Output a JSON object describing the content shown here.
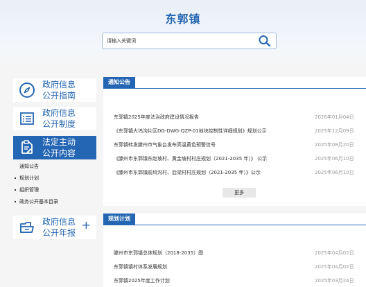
{
  "header": {
    "site_title": "东郭镇",
    "search_placeholder": "请输入关键词"
  },
  "nav": {
    "items": [
      {
        "line1": "政府信息",
        "line2": "公开指南",
        "icon": "compass-icon"
      },
      {
        "line1": "政府信息",
        "line2": "公开制度",
        "icon": "document-list-icon"
      },
      {
        "line1": "法定主动",
        "line2": "公开内容",
        "icon": "edit-document-icon",
        "active": true
      },
      {
        "line1": "政府信息",
        "line2": "公开年报",
        "icon": "folder-icon",
        "expand": "+"
      }
    ],
    "sub_items": [
      "通知公告",
      "规划计划",
      "组织管理",
      "政务公开基本目录"
    ]
  },
  "notices": {
    "title": "通知公告",
    "more_label": "更多",
    "items": [
      {
        "title": "东郭镇2025年度法治政府建设情况报告",
        "date": "2026年01月04日"
      },
      {
        "title": "《东郭镇大坞沟片区DG-DWG-QZP-01地块控制性详细规划》规划公示",
        "date": "2025年12月09日"
      },
      {
        "title": "东郭镇转发滕州市气象台发布高温黄色预警信号",
        "date": "2025年08月20日"
      },
      {
        "title": "《滕州市东郭镇东赵坡村、黄金坡村村庄规划（2021-2035 年）》 公示",
        "date": "2025年06月10日"
      },
      {
        "title": "《滕州市东郭镇前坞沟村、后梁村村庄规划（2021-2035 年）》公示",
        "date": "2025年06月10日"
      }
    ]
  },
  "plans": {
    "title": "规划计划",
    "items": [
      {
        "title": "滕州市东郭镇总体规划（2018-2035）图",
        "date": "2025年04月02日"
      },
      {
        "title": "东郭镇镇村体系发展规划",
        "date": "2025年04月02日"
      },
      {
        "title": "东郭镇2025年度工作计划",
        "date": "2025年03月24日"
      }
    ]
  },
  "colors": {
    "accent": "#2466b3"
  }
}
